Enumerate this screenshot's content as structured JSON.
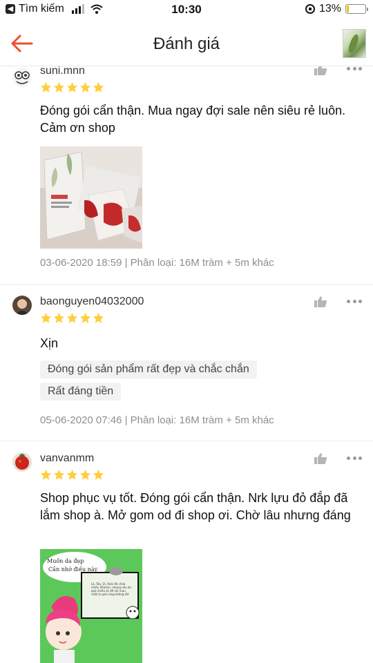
{
  "status_bar": {
    "back_app_label": "Tìm kiếm",
    "time": "10:30",
    "battery_percent": "13%",
    "battery_level": 0.13
  },
  "header": {
    "title": "Đánh giá"
  },
  "reviews": [
    {
      "username": "suni.mnn",
      "stars": 5,
      "text": "Đóng gói cẩn thận. Mua ngay đợi sale nên siêu rẻ luôn. Cảm ơn shop",
      "meta": "03-06-2020 18:59 | Phân loại: 16M tràm + 5m khác"
    },
    {
      "username": "baonguyen04032000",
      "stars": 5,
      "text": "Xịn",
      "tags": [
        "Đóng gói sản phẩm rất đẹp và chắc chắn",
        "Rất đáng tiền"
      ],
      "meta": "05-06-2020 07:46 | Phân loại: 16M tràm + 5m khác"
    },
    {
      "username": "vanvanmm",
      "stars": 5,
      "text": "Shop phục vụ tốt. Đóng gói cẩn thận. Nrk lựu đỏ đắp đã lắm shop à. Mở gom od đi shop ơi. Chờ lâu nhưng đáng",
      "photo_caption_1": "Muốn da đẹp",
      "photo_caption_2": "Cần nhớ điều này",
      "photo_small_text": "Lá, Táo, Ổi, Xoài đỏ chứa nhiều Vitamin, nhưng nếu ăn quá nhiều sẽ dễ nổi mụn, nhất là quả cũng không tốt"
    }
  ],
  "colors": {
    "accent": "#ee4d2d",
    "star": "#ffce3d",
    "meta": "#8e8e8e"
  }
}
